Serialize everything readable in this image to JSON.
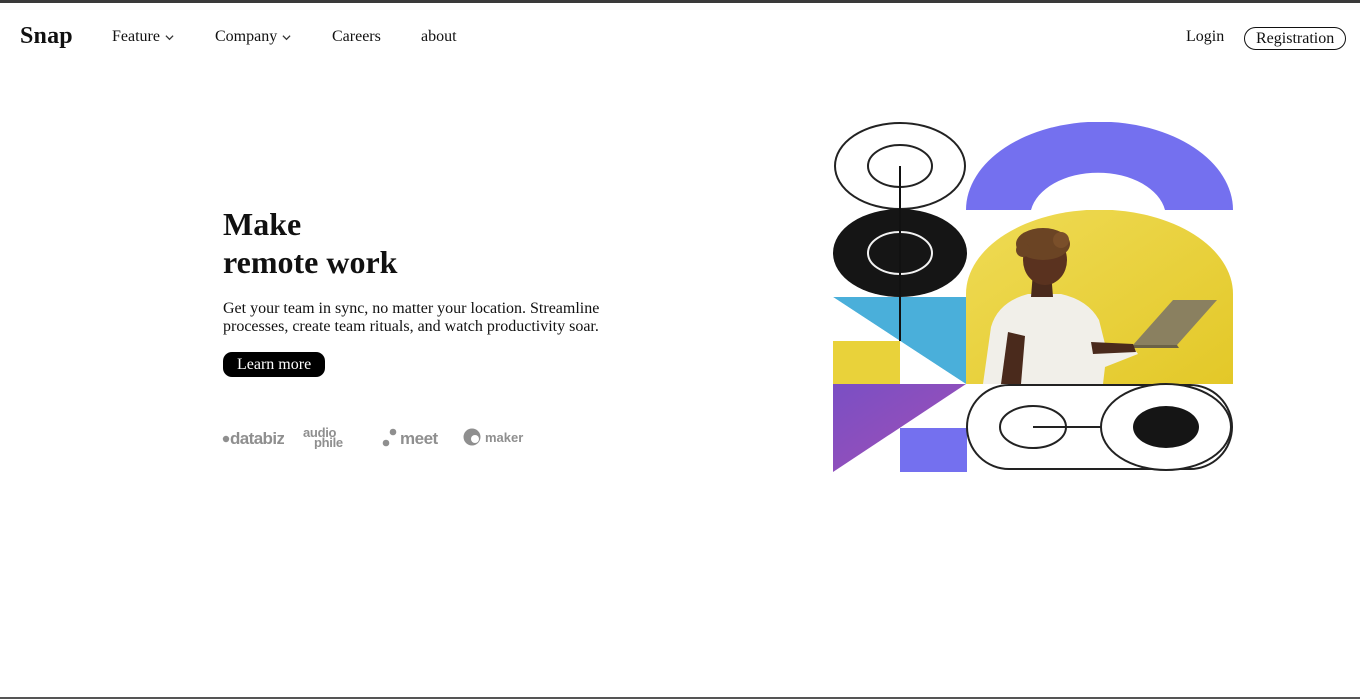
{
  "nav": {
    "logo": "Snap",
    "items": [
      {
        "label": "Feature",
        "icon": "chevron-down-icon"
      },
      {
        "label": "Company",
        "icon": "chevron-down-icon"
      },
      {
        "label": "Careers"
      },
      {
        "label": "about"
      }
    ],
    "login_label": "Login",
    "register_label": "Registration"
  },
  "hero": {
    "title_line1": "Make",
    "title_line2": "remote work",
    "description": "Get your team in sync, no matter your location. Streamline processes, create team rituals, and watch productivity soar.",
    "cta_label": "Learn more"
  },
  "clients": {
    "databiz": "databiz",
    "audiophile_top": "audio",
    "audiophile_bottom": "phile",
    "meet": "meet",
    "maker": "maker"
  },
  "colors": {
    "text": "#111111",
    "purple": "#7470ef",
    "yellow": "#e9d23a",
    "blue": "#4aafda",
    "violet": "#8e48b9",
    "client_gray": "#8f8f8f"
  }
}
